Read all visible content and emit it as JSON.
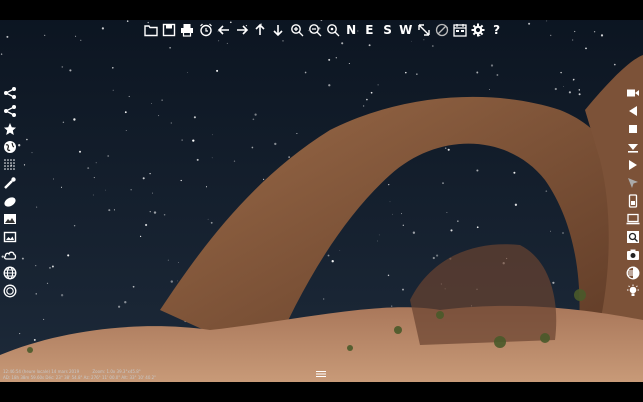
{
  "toolbar": {
    "items": [
      {
        "icon": "folder-icon"
      },
      {
        "icon": "save-icon"
      },
      {
        "icon": "print-icon"
      },
      {
        "icon": "alarm-clock-icon"
      },
      {
        "icon": "arrow-left-icon"
      },
      {
        "icon": "arrow-right-icon"
      },
      {
        "icon": "arrow-up-icon"
      },
      {
        "icon": "arrow-down-icon"
      },
      {
        "icon": "zoom-in-icon"
      },
      {
        "icon": "zoom-out-icon"
      },
      {
        "icon": "zoom-fit-icon"
      },
      {
        "label": "N"
      },
      {
        "label": "E"
      },
      {
        "label": "S"
      },
      {
        "label": "W"
      },
      {
        "icon": "diagonal-arrow-icon"
      },
      {
        "icon": "no-sign-icon"
      },
      {
        "icon": "calendar-icon"
      },
      {
        "icon": "gear-icon"
      },
      {
        "label": "?"
      }
    ]
  },
  "status": {
    "line1": {
      "time": "12:46:54 (heure locale) 14 mars 2019",
      "zoom": "Zoom: 1.0x 39.3°x45.8°"
    },
    "line2": {
      "coords": "AD: 18h 38m 59.60s Déc: 23° 38' 54.8\"  Az: 276° 11' 00.0\" Alt: 33° 10' 40.2\""
    }
  },
  "colors": {
    "sky_top": "#0c1522",
    "sky_bottom": "#1d2a3c",
    "rock": "#8a5a3a",
    "rock_shadow": "#4e3020",
    "ground": "#b07a55"
  }
}
